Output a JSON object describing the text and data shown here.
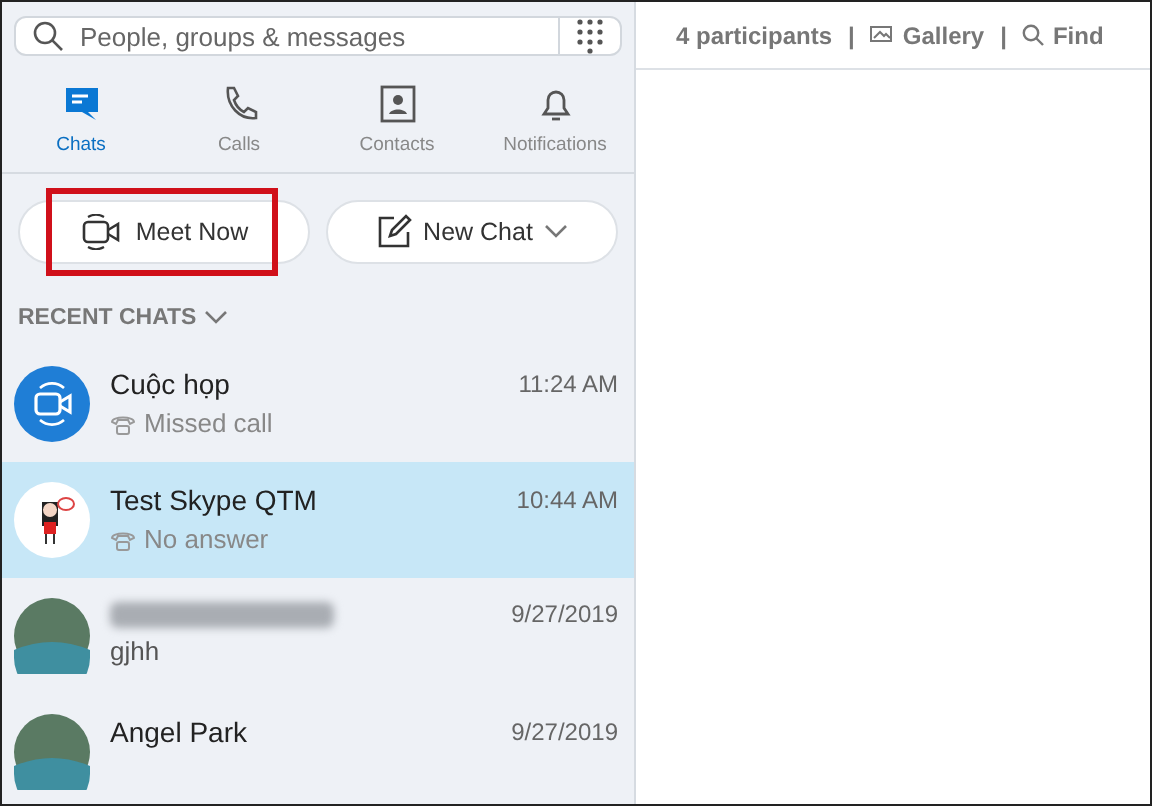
{
  "search": {
    "placeholder": "People, groups & messages"
  },
  "nav_tabs": [
    {
      "label": "Chats",
      "kind": "chats",
      "selected": true
    },
    {
      "label": "Calls",
      "kind": "calls",
      "selected": false
    },
    {
      "label": "Contacts",
      "kind": "contacts",
      "selected": false
    },
    {
      "label": "Notifications",
      "kind": "notifications",
      "selected": false
    }
  ],
  "actions": [
    {
      "label": "Meet Now",
      "kind": "meet",
      "highlighted": true
    },
    {
      "label": "New Chat",
      "kind": "new",
      "highlighted": false
    }
  ],
  "recent_chats": {
    "heading": "RECENT CHATS",
    "items": [
      {
        "name": "Cuộc họp",
        "time": "11:24 AM",
        "preview": "Missed call",
        "call_status": true,
        "kind": "meeting",
        "selected": false
      },
      {
        "name": "Test Skype QTM",
        "time": "10:44 AM",
        "preview": "No answer",
        "call_status": true,
        "kind": "cartoon",
        "selected": true
      },
      {
        "time": "9/27/2019",
        "preview": "gjhh",
        "call_status": false,
        "kind": "photo",
        "selected": false
      },
      {
        "name": "Angel Park",
        "time": "9/27/2019",
        "call_status": false,
        "kind": "photo",
        "selected": false
      }
    ]
  },
  "header": [
    {
      "kind": "count",
      "text": "4 participants"
    },
    {
      "kind": "separator",
      "text": "|"
    },
    {
      "kind": "gallery",
      "text": "Gallery"
    },
    {
      "kind": "separator",
      "text": "|"
    },
    {
      "kind": "find",
      "text": "Find"
    }
  ]
}
